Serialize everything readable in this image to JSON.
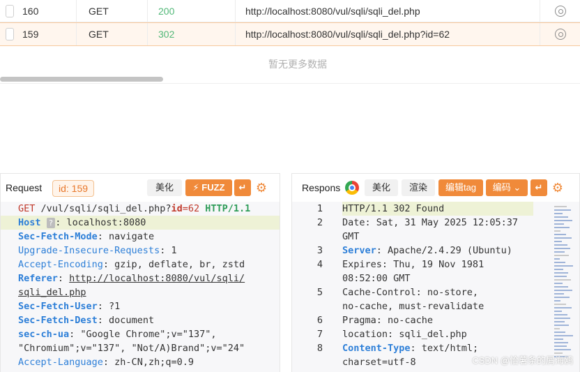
{
  "history": {
    "rows": [
      {
        "id": "160",
        "method": "GET",
        "status": "200",
        "url": "http://localhost:8080/vul/sqli/sqli_del.php"
      },
      {
        "id": "159",
        "method": "GET",
        "status": "302",
        "url": "http://localhost:8080/vul/sqli/sqli_del.php?id=62"
      }
    ],
    "no_more": "暂无更多数据"
  },
  "request": {
    "title": "Request",
    "id_badge": "id: 159",
    "beautify_label": "美化",
    "fuzz_label": "FUZZ",
    "lines": [
      {
        "parts": [
          [
            "GET",
            "k-red2"
          ],
          [
            " /vul/sqli/sqli_del.php?",
            ""
          ],
          [
            "id",
            "k-red2 k-bold"
          ],
          [
            "=62",
            "k-red2"
          ],
          [
            " HTTP/1.1",
            "k-green k-bold"
          ]
        ]
      },
      {
        "parts": [
          [
            "Host",
            "k-blue k-bold"
          ],
          [
            " ",
            ""
          ],
          [
            "?",
            "q"
          ],
          [
            ": localhost:8080",
            ""
          ]
        ],
        "hl": true
      },
      {
        "parts": [
          [
            "Sec-Fetch-Mode",
            "k-blue k-bold"
          ],
          [
            ": navigate",
            ""
          ]
        ]
      },
      {
        "parts": [
          [
            "Upgrade-Insecure-Requests",
            "k-blue"
          ],
          [
            ": 1",
            ""
          ]
        ]
      },
      {
        "parts": [
          [
            "Accept-Encoding",
            "k-blue"
          ],
          [
            ": gzip, deflate, br, zstd",
            ""
          ]
        ]
      },
      {
        "parts": [
          [
            "Referer",
            "k-blue k-bold"
          ],
          [
            ": ",
            ""
          ],
          [
            "http://localhost:8080/vul/sqli/",
            "ul"
          ]
        ]
      },
      {
        "parts": [
          [
            "sqli_del.php",
            "ul"
          ]
        ]
      },
      {
        "parts": [
          [
            "Sec-Fetch-User",
            "k-blue k-bold"
          ],
          [
            ": ?1",
            ""
          ]
        ]
      },
      {
        "parts": [
          [
            "Sec-Fetch-Dest",
            "k-blue k-bold"
          ],
          [
            ": document",
            ""
          ]
        ]
      },
      {
        "parts": [
          [
            "sec-ch-ua",
            "k-blue k-bold"
          ],
          [
            ": \"Google Chrome\";v=\"137\",",
            ""
          ]
        ]
      },
      {
        "parts": [
          [
            "\"Chromium\";v=\"137\", \"Not/A)Brand\";v=\"24\"",
            ""
          ]
        ]
      },
      {
        "parts": [
          [
            "Accept-Language",
            "k-blue"
          ],
          [
            ": zh-CN,zh;q=0.9",
            ""
          ]
        ]
      }
    ]
  },
  "response": {
    "title": "Respons",
    "beautify_label": "美化",
    "render_label": "渲染",
    "edit_tag_label": "编辑tag",
    "encode_label": "编码",
    "lines": [
      {
        "num": "1",
        "parts": [
          [
            "HTTP/1.1 302 Found",
            ""
          ]
        ],
        "hl": true
      },
      {
        "num": "2",
        "parts": [
          [
            "Date: Sat, 31 May 2025 12:05:37",
            ""
          ]
        ]
      },
      {
        "num": "",
        "parts": [
          [
            "GMT",
            ""
          ]
        ]
      },
      {
        "num": "3",
        "parts": [
          [
            "Server",
            "k-blue k-bold"
          ],
          [
            ": Apache/2.4.29 (Ubuntu)",
            ""
          ]
        ]
      },
      {
        "num": "4",
        "parts": [
          [
            "Expires: Thu, 19 Nov 1981",
            ""
          ]
        ]
      },
      {
        "num": "",
        "parts": [
          [
            "08:52:00 GMT",
            ""
          ]
        ]
      },
      {
        "num": "5",
        "parts": [
          [
            "Cache-Control: no-store,",
            ""
          ]
        ]
      },
      {
        "num": "",
        "parts": [
          [
            "no-cache, must-revalidate",
            ""
          ]
        ]
      },
      {
        "num": "6",
        "parts": [
          [
            "Pragma: no-cache",
            ""
          ]
        ]
      },
      {
        "num": "7",
        "parts": [
          [
            "location: sqli_del.php",
            ""
          ]
        ]
      },
      {
        "num": "8",
        "parts": [
          [
            "Content-Type",
            "k-blue k-bold"
          ],
          [
            ": text/html;",
            ""
          ]
        ]
      },
      {
        "num": "",
        "parts": [
          [
            "charset=utf-8",
            ""
          ]
        ]
      }
    ]
  },
  "watermark": "CSDN @恰薯条的屑海鸥"
}
